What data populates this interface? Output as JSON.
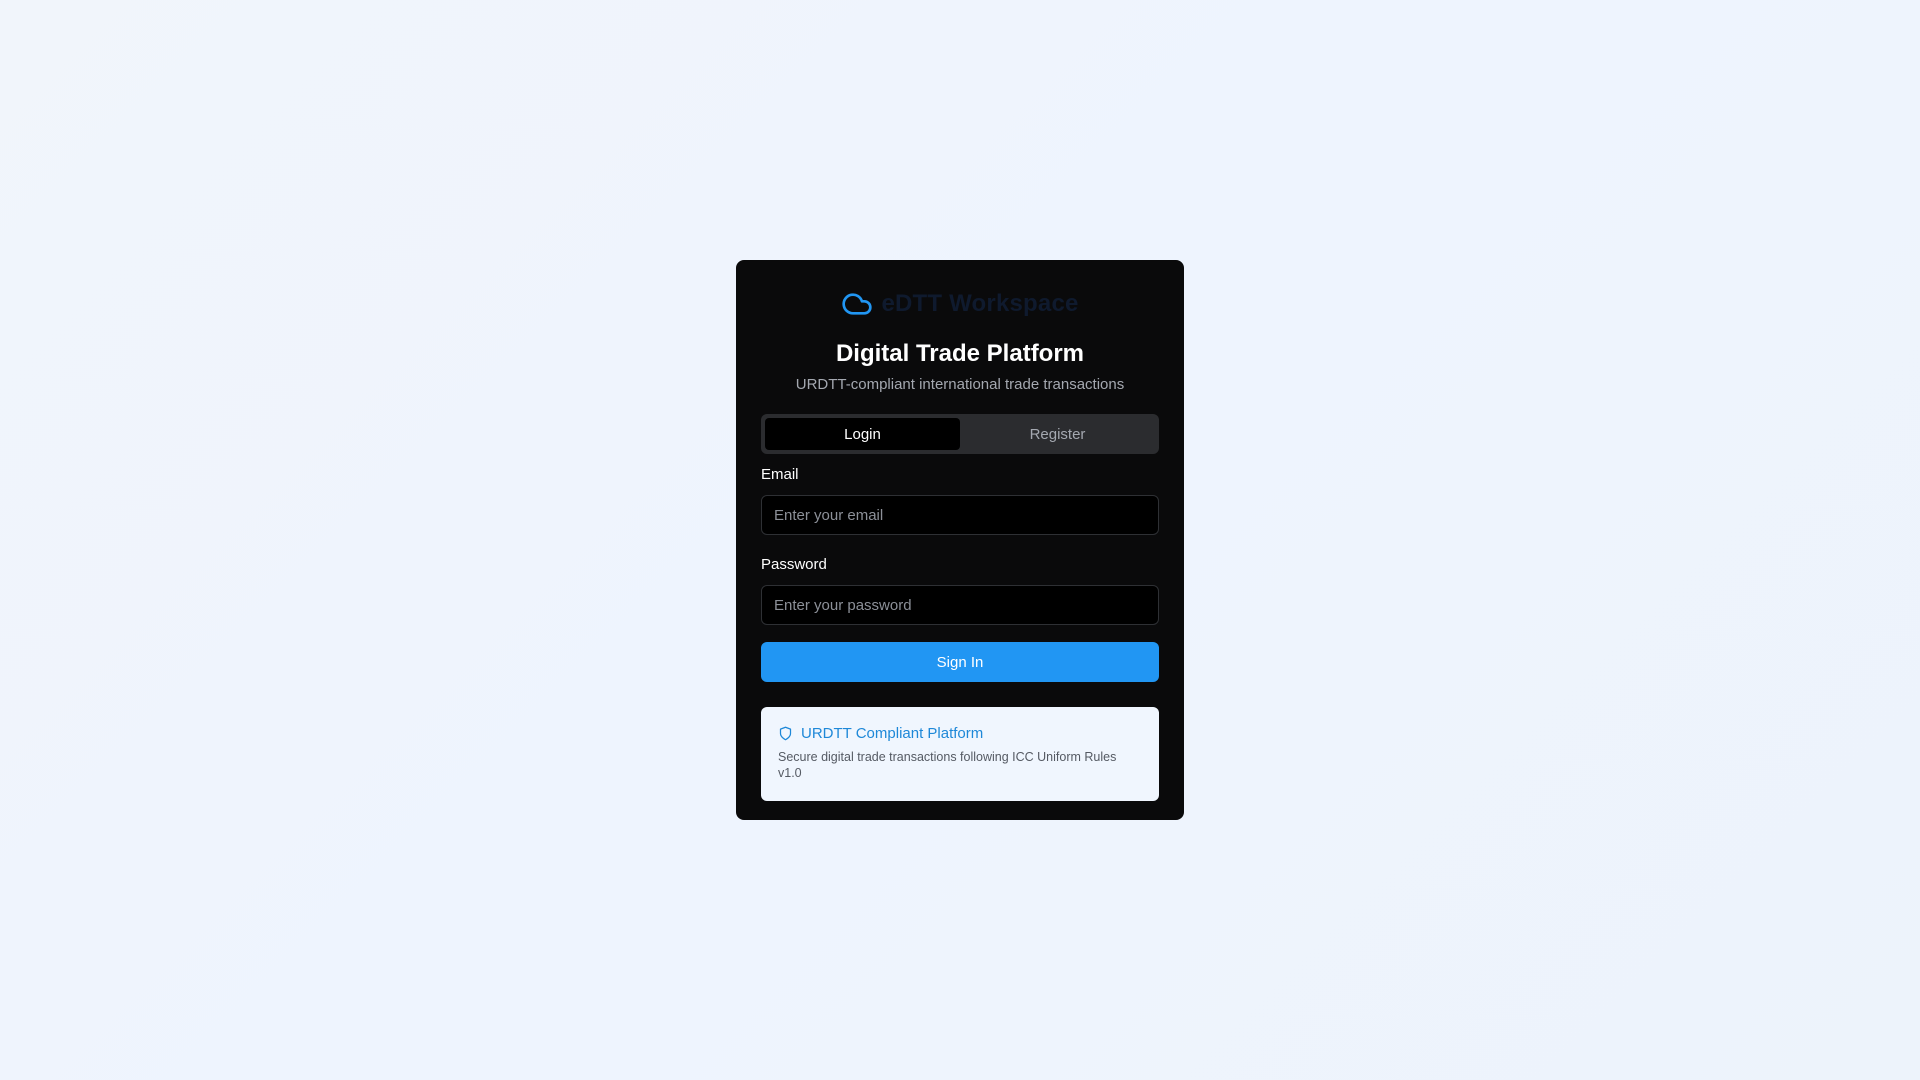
{
  "brand": {
    "name": "eDTT Workspace",
    "icon": "cloud-icon",
    "icon_color": "#2196f3"
  },
  "header": {
    "title": "Digital Trade Platform",
    "subtitle": "URDTT-compliant international trade transactions"
  },
  "tabs": [
    {
      "label": "Login",
      "active": true
    },
    {
      "label": "Register",
      "active": false
    }
  ],
  "form": {
    "email_label": "Email",
    "email_value": "",
    "email_placeholder": "Enter your email",
    "password_label": "Password",
    "password_value": "",
    "password_placeholder": "Enter your password",
    "submit_label": "Sign In"
  },
  "notice": {
    "icon": "shield-icon",
    "title": "URDTT Compliant Platform",
    "text": "Secure digital trade transactions following ICC Uniform Rules v1.0"
  },
  "colors": {
    "accent": "#2196f3",
    "card_background": "#0a0a0b",
    "page_background": "#eef4fe",
    "notice_background": "#f0f6fe"
  }
}
